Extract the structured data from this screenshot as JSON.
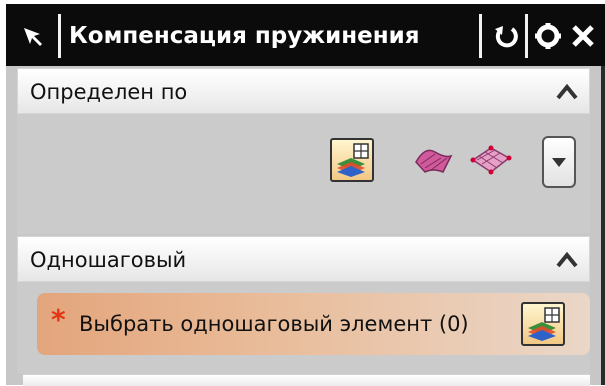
{
  "titlebar": {
    "title": "Компенсация пружинения",
    "pin_icon": "pin-arrow-icon",
    "reset_icon": "reset-icon",
    "settings_icon": "gear-icon",
    "close_icon": "close-icon"
  },
  "groups": {
    "defined_by": {
      "label": "Определен по",
      "options": [
        "layered-body-icon",
        "surface-wave-icon",
        "mesh-surface-icon"
      ],
      "selected_index": 0
    },
    "single_step": {
      "label": "Одношаговый",
      "select_required_marker": "*",
      "select_label": "Выбрать одношаговый элемент (0)"
    }
  },
  "colors": {
    "titlebar_bg": "#0b0b0b",
    "panel_bg": "#c7c7c7",
    "select_row_accent": "#e3a57c",
    "required_marker": "#e23515"
  }
}
